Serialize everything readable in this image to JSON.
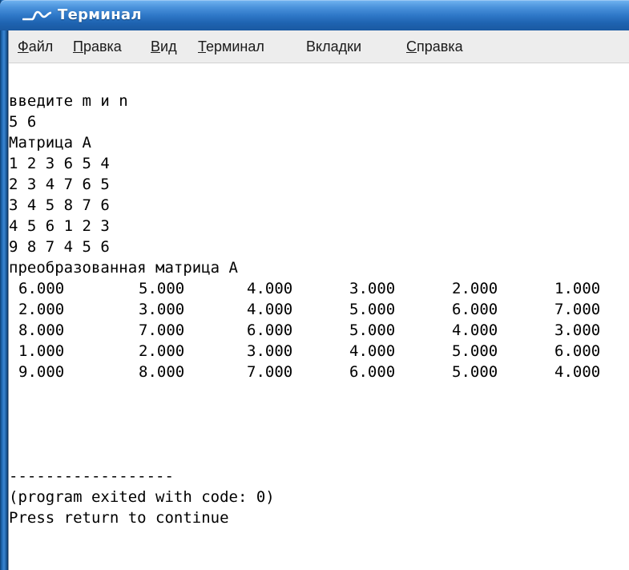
{
  "window": {
    "title": "Терминал",
    "title_icon": "terminal-wave-icon",
    "titlebar_color": "#2f78c8"
  },
  "menubar": {
    "items": [
      {
        "accel": "Ф",
        "rest": "айл"
      },
      {
        "accel": "П",
        "rest": "равка"
      },
      {
        "accel": "В",
        "rest": "ид"
      },
      {
        "accel": "Т",
        "rest": "ерминал"
      },
      {
        "accel": "",
        "rest": "Вкладки"
      },
      {
        "accel": "С",
        "rest": "правка"
      }
    ]
  },
  "terminal": {
    "prompt": "введите m и n",
    "input": "5 6",
    "matrix_label": "Матрица A",
    "matrix_rows": [
      "1 2 3 6 5 4",
      "2 3 4 7 6 5",
      "3 4 5 8 7 6",
      "4 5 6 1 2 3",
      "9 8 7 4 5 6"
    ],
    "transformed_label": "преобразованная матрица A",
    "transformed_rows": [
      [
        "6.000",
        "5.000",
        "4.000",
        "3.000",
        "2.000",
        "1.000"
      ],
      [
        "2.000",
        "3.000",
        "4.000",
        "5.000",
        "6.000",
        "7.000"
      ],
      [
        "8.000",
        "7.000",
        "6.000",
        "5.000",
        "4.000",
        "3.000"
      ],
      [
        "1.000",
        "2.000",
        "3.000",
        "4.000",
        "5.000",
        "6.000"
      ],
      [
        "9.000",
        "8.000",
        "7.000",
        "6.000",
        "5.000",
        "4.000"
      ]
    ],
    "separator": "------------------",
    "exit_message": "(program exited with code: 0)",
    "continue_message": "Press return to continue"
  }
}
